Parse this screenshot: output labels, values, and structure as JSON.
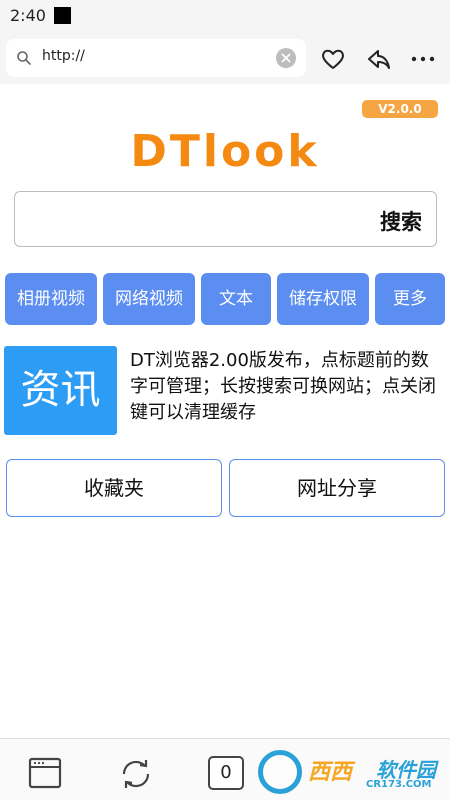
{
  "status_bar": {
    "time": "2:40"
  },
  "url_bar": {
    "text": "http://"
  },
  "version": "V2.0.0",
  "logo": "DTlook",
  "search": {
    "label": "搜索"
  },
  "categories": [
    "相册视频",
    "网络视频",
    "文本",
    "储存权限",
    "更多"
  ],
  "news": {
    "tile_label": "资讯",
    "message": "DT浏览器2.00版发布，点标题前的数字可管理；长按搜索可换网站；点关闭键可以清理缓存"
  },
  "actions": {
    "favorites": "收藏夹",
    "share_url": "网址分享"
  },
  "bottom_bar": {
    "tab_count": "0"
  },
  "watermark": {
    "brand": "西西",
    "brand2": "软件园",
    "domain": "CR173.COM"
  },
  "colors": {
    "accent_blue": "#5b8ef0",
    "logo_orange": "#f58a12",
    "news_blue": "#2c9cf4",
    "badge_orange": "#f5a642"
  }
}
